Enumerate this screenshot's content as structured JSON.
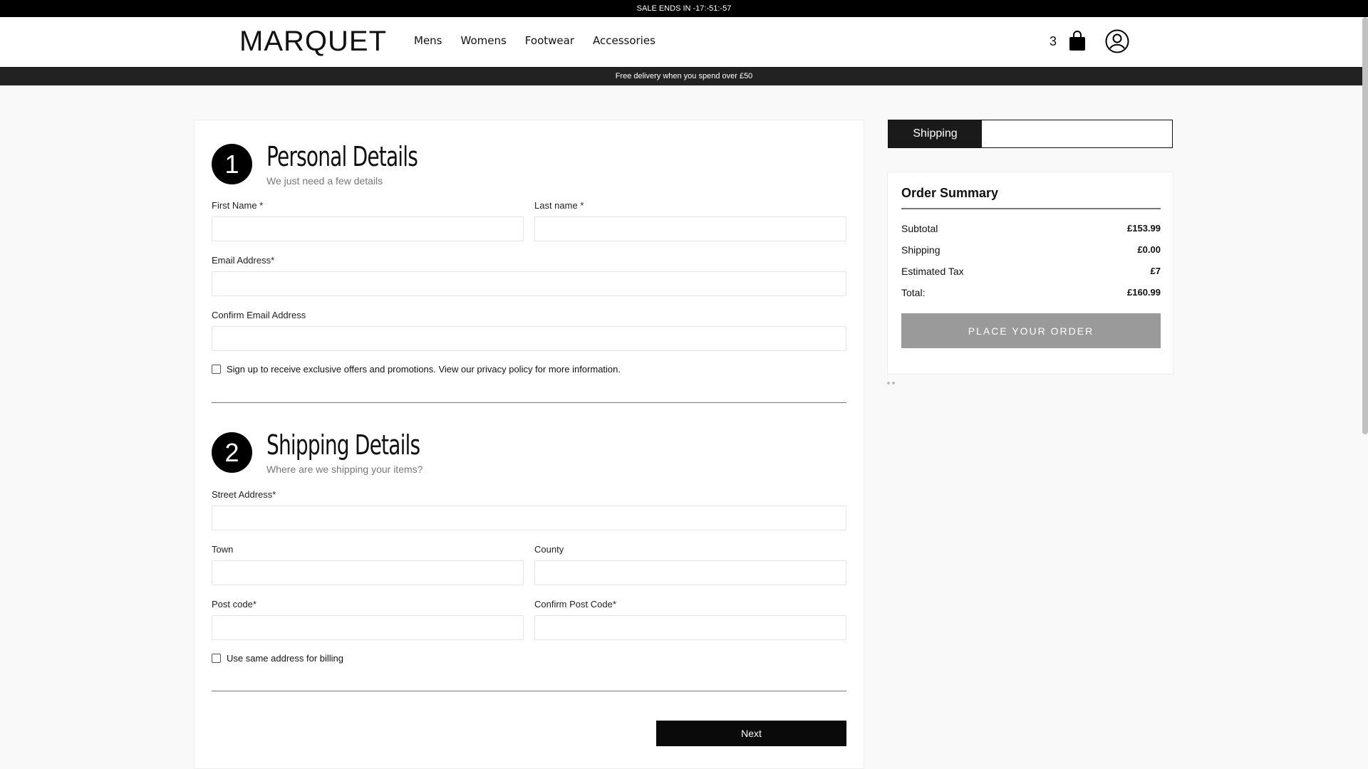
{
  "topbar": {
    "sale_text": "SALE ENDS IN -17:-51:-57"
  },
  "header": {
    "logo": "MARQUET",
    "nav": [
      "Mens",
      "Womens",
      "Footwear",
      "Accessories"
    ],
    "cart_count": "3",
    "cart_icon": "shopping-bag-icon",
    "account_icon": "user-circle-icon"
  },
  "promo": {
    "text": "Free delivery when you spend over £50"
  },
  "personal": {
    "step": "1",
    "title": "Personal Details",
    "subtitle": "We just need a few details",
    "first_name_label": "First Name *",
    "last_name_label": "Last name *",
    "email_label": "Email Address*",
    "confirm_email_label": "Confirm Email Address",
    "signup_text": "Sign up to receive exclusive offers and promotions. View our privacy policy for more information."
  },
  "shipping": {
    "step": "2",
    "title": "Shipping Details",
    "subtitle": "Where are we shipping your items?",
    "street_label": "Street Address*",
    "town_label": "Town",
    "county_label": "County",
    "postcode_label": "Post code*",
    "confirm_postcode_label": "Confirm Post Code*",
    "same_billing_text": "Use same address for billing"
  },
  "next_label": "Next",
  "tabs": {
    "active": "Shipping"
  },
  "summary": {
    "title": "Order Summary",
    "rows": [
      {
        "label": "Subtotal",
        "value": "£153.99"
      },
      {
        "label": "Shipping",
        "value": "£0.00"
      },
      {
        "label": "Estimated Tax",
        "value": "£7"
      },
      {
        "label": "Total:",
        "value": "£160.99"
      }
    ],
    "place_order": "PLACE YOUR ORDER"
  }
}
